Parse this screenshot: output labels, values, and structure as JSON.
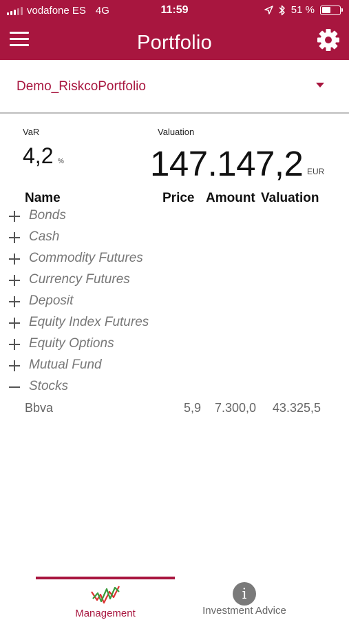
{
  "status_bar": {
    "carrier": "vodafone ES",
    "network": "4G",
    "time": "11:59",
    "battery": "51 %",
    "battery_level": 0.51,
    "icons": [
      "signal-icon",
      "location-arrow-icon",
      "bluetooth-icon",
      "battery-icon"
    ]
  },
  "header": {
    "title": "Portfolio",
    "menu_icon": "hamburger-menu-icon",
    "settings_icon": "gear-icon"
  },
  "portfolio_selector": {
    "selected": "Demo_RiskcoPortfolio",
    "icon": "caret-down-icon"
  },
  "summary": {
    "var_label": "VaR",
    "var_value": "4,2",
    "var_unit": "%",
    "valuation_label": "Valuation",
    "valuation_value": "147.147,2",
    "valuation_unit": "EUR"
  },
  "table": {
    "columns": [
      "Name",
      "Price",
      "Amount",
      "Valuation"
    ],
    "groups": [
      {
        "label": "Bonds",
        "expanded": false
      },
      {
        "label": "Cash",
        "expanded": false
      },
      {
        "label": "Commodity Futures",
        "expanded": false
      },
      {
        "label": "Currency Futures",
        "expanded": false
      },
      {
        "label": "Deposit",
        "expanded": false
      },
      {
        "label": "Equity Index Futures",
        "expanded": false
      },
      {
        "label": "Equity Options",
        "expanded": false
      },
      {
        "label": "Mutual Fund",
        "expanded": false
      },
      {
        "label": "Stocks",
        "expanded": true
      }
    ],
    "rows": [
      {
        "name": "Bbva",
        "price": "5,9",
        "amount": "7.300,0",
        "valuation": "43.325,5"
      }
    ]
  },
  "tab_bar": {
    "tabs": [
      {
        "label": "Management",
        "icon": "chart-line-icon",
        "active": true
      },
      {
        "label": "Investment Advice",
        "icon": "info-icon",
        "active": false
      }
    ]
  },
  "colors": {
    "brand": "#a8163f",
    "muted_text": "#777777",
    "divider": "#bdbdbd"
  }
}
